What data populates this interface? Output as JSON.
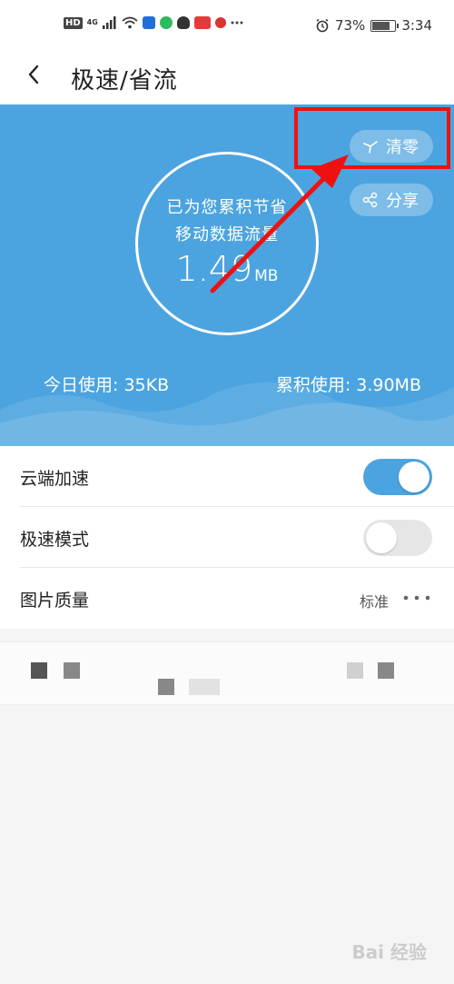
{
  "status_bar": {
    "hd_label": "HD",
    "network_label": "4G",
    "battery_percent": "73%",
    "battery_level": 0.73,
    "time": "3:34"
  },
  "header": {
    "title": "极速/省流"
  },
  "savings_panel": {
    "line1": "已为您累积节省",
    "line2": "移动数据流量",
    "value": "1.49",
    "unit": "MB",
    "clear_label": "清零",
    "share_label": "分享",
    "today_usage": "今日使用: 35KB",
    "total_usage": "累积使用: 3.90MB"
  },
  "settings": {
    "cloud_accel": {
      "label": "云端加速",
      "enabled": true
    },
    "speed_mode": {
      "label": "极速模式",
      "enabled": false
    },
    "image_quality": {
      "label": "图片质量",
      "value": "标准"
    }
  },
  "colors": {
    "accent_blue": "#4ba4df",
    "annotation_red": "#ee1111"
  },
  "watermark": "Bai 经验"
}
